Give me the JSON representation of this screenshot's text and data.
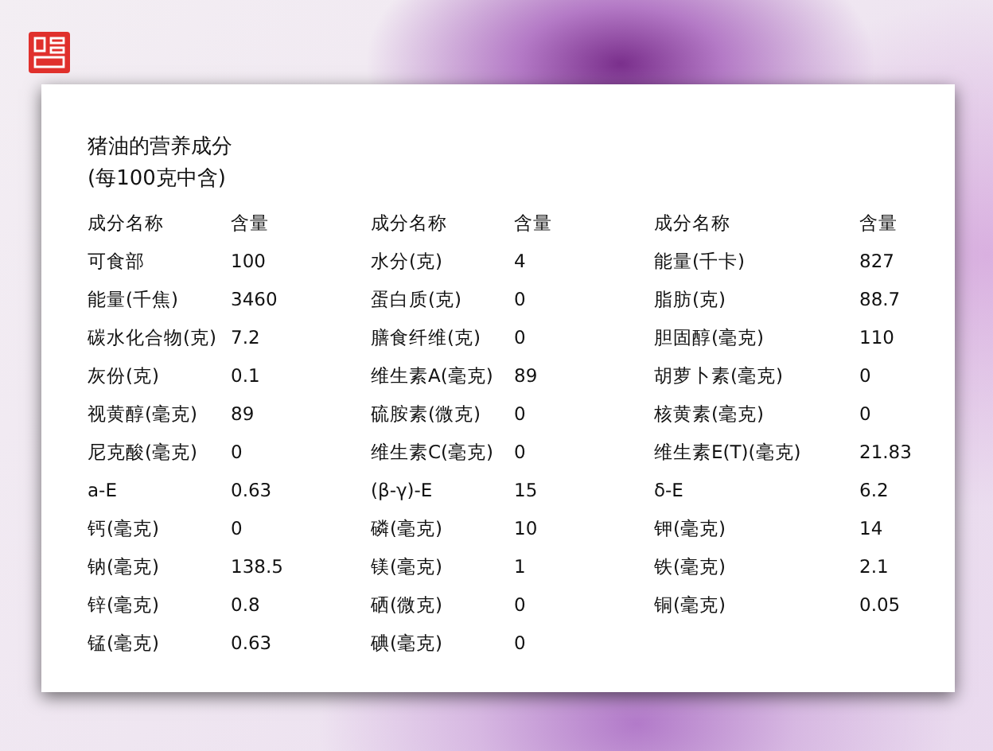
{
  "title": "猪油的营养成分",
  "subtitle": "(每100克中含)",
  "table": {
    "columns": [
      "成分名称",
      "含量",
      "成分名称",
      "含量",
      "成分名称",
      "含量"
    ],
    "rows": [
      [
        "可食部",
        "100",
        "水分(克)",
        "4",
        "能量(千卡)",
        "827"
      ],
      [
        "能量(千焦)",
        "3460",
        "蛋白质(克)",
        "0",
        "脂肪(克)",
        "88.7"
      ],
      [
        "碳水化合物(克)",
        "7.2",
        "膳食纤维(克)",
        "0",
        "胆固醇(毫克)",
        "110"
      ],
      [
        "灰份(克)",
        "0.1",
        "维生素A(毫克)",
        "89",
        "胡萝卜素(毫克)",
        "0"
      ],
      [
        "视黄醇(毫克)",
        "89",
        "硫胺素(微克)",
        "0",
        "核黄素(毫克)",
        "0"
      ],
      [
        "尼克酸(毫克)",
        "0",
        "维生素C(毫克)",
        "0",
        "维生素E(T)(毫克)",
        "21.83"
      ],
      [
        "a-E",
        "0.63",
        "(β-γ)-E",
        "15",
        "δ-E",
        "6.2"
      ],
      [
        "钙(毫克)",
        "0",
        "磷(毫克)",
        "10",
        "钾(毫克)",
        "14"
      ],
      [
        "钠(毫克)",
        "138.5",
        "镁(毫克)",
        "1",
        "铁(毫克)",
        "2.1"
      ],
      [
        "锌(毫克)",
        "0.8",
        "硒(微克)",
        "0",
        "铜(毫克)",
        "0.05"
      ],
      [
        "锰(毫克)",
        "0.63",
        "碘(毫克)",
        "0"
      ]
    ]
  }
}
